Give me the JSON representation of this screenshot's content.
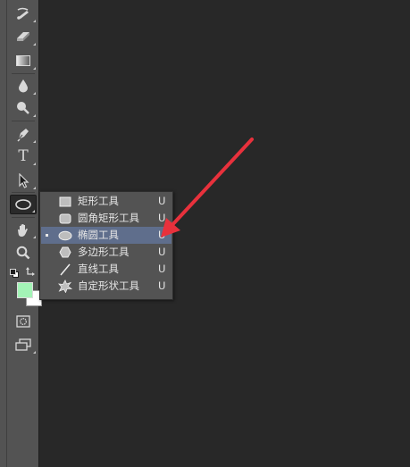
{
  "toolbar": {
    "tools": [
      {
        "name": "history-brush-tool",
        "icon": "history-brush-icon"
      },
      {
        "name": "eraser-tool",
        "icon": "eraser-icon"
      },
      {
        "name": "gradient-tool",
        "icon": "gradient-icon"
      },
      {
        "name": "blur-tool",
        "icon": "drop-icon"
      },
      {
        "name": "dodge-tool",
        "icon": "dodge-icon"
      },
      {
        "name": "pen-tool",
        "icon": "pen-icon"
      },
      {
        "name": "type-tool",
        "icon": "type-icon",
        "glyph": "T"
      },
      {
        "name": "path-selection-tool",
        "icon": "path-selection-icon"
      },
      {
        "name": "ellipse-tool",
        "icon": "ellipse-icon",
        "active": true
      },
      {
        "name": "hand-tool",
        "icon": "hand-icon"
      },
      {
        "name": "zoom-tool",
        "icon": "zoom-icon"
      }
    ],
    "colors": {
      "foreground": "#a3f3b6",
      "background": "#ffffff"
    }
  },
  "flyout": {
    "items": [
      {
        "label": "矩形工具",
        "shortcut": "U",
        "icon": "rectangle-icon",
        "selected": false
      },
      {
        "label": "圆角矩形工具",
        "shortcut": "U",
        "icon": "rounded-rectangle-icon",
        "selected": false
      },
      {
        "label": "椭圆工具",
        "shortcut": "U",
        "icon": "ellipse-icon",
        "selected": true
      },
      {
        "label": "多边形工具",
        "shortcut": "U",
        "icon": "polygon-icon",
        "selected": false
      },
      {
        "label": "直线工具",
        "shortcut": "U",
        "icon": "line-icon",
        "selected": false
      },
      {
        "label": "自定形状工具",
        "shortcut": "U",
        "icon": "custom-shape-icon",
        "selected": false
      }
    ]
  },
  "annotation": {
    "color": "#e8313c",
    "points_to": "椭圆工具"
  }
}
